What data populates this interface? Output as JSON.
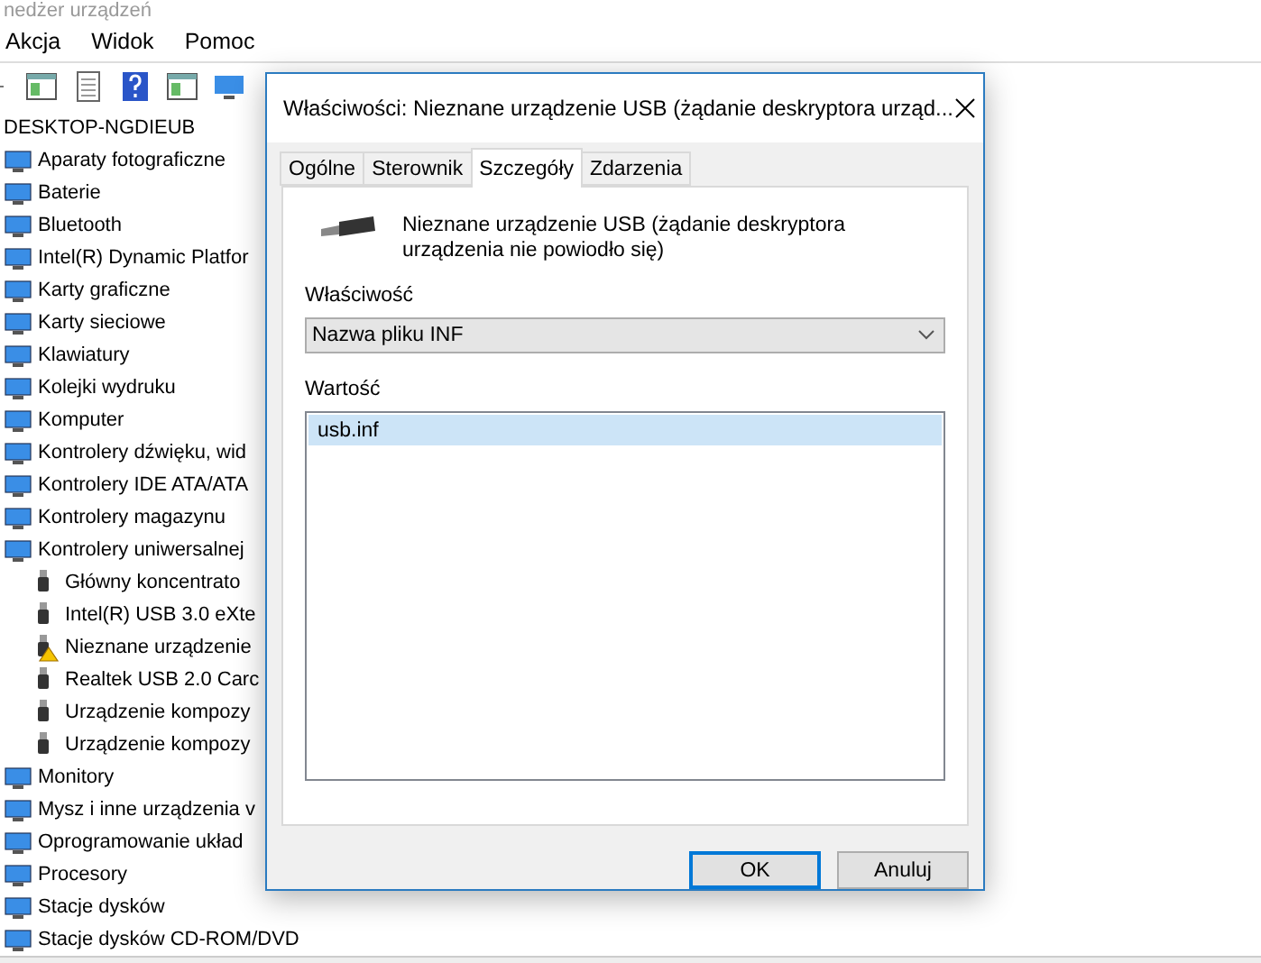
{
  "window": {
    "title": "nedżer urządzeń"
  },
  "menu": [
    "Akcja",
    "Widok",
    "Pomoc"
  ],
  "tree": {
    "label": "DESKTOP-NGDIEUB",
    "children": [
      {
        "label": "Aparaty fotograficzne"
      },
      {
        "label": "Baterie"
      },
      {
        "label": "Bluetooth"
      },
      {
        "label": "Intel(R) Dynamic Platfor"
      },
      {
        "label": "Karty graficzne"
      },
      {
        "label": "Karty sieciowe"
      },
      {
        "label": "Klawiatury"
      },
      {
        "label": "Kolejki wydruku"
      },
      {
        "label": "Komputer"
      },
      {
        "label": "Kontrolery dźwięku, wid"
      },
      {
        "label": "Kontrolery IDE ATA/ATA"
      },
      {
        "label": "Kontrolery magazynu"
      },
      {
        "label": "Kontrolery uniwersalnej",
        "children": [
          {
            "label": "Główny koncentrato",
            "warning": false
          },
          {
            "label": "Intel(R) USB 3.0 eXte",
            "warning": false
          },
          {
            "label": "Nieznane urządzenie",
            "warning": true
          },
          {
            "label": "Realtek USB 2.0 Carc",
            "warning": false
          },
          {
            "label": "Urządzenie kompozy",
            "warning": false
          },
          {
            "label": "Urządzenie kompozy",
            "warning": false
          }
        ]
      },
      {
        "label": "Monitory"
      },
      {
        "label": "Mysz i inne urządzenia v"
      },
      {
        "label": "Oprogramowanie układ"
      },
      {
        "label": "Procesory"
      },
      {
        "label": "Stacje dysków"
      },
      {
        "label": "Stacje dysków CD-ROM/DVD"
      }
    ]
  },
  "dialog": {
    "title": "Właściwości: Nieznane urządzenie USB (żądanie deskryptora urząd...",
    "tabs": [
      {
        "label": "Ogólne",
        "selected": false
      },
      {
        "label": "Sterownik",
        "selected": false
      },
      {
        "label": "Szczegóły",
        "selected": true
      },
      {
        "label": "Zdarzenia",
        "selected": false
      }
    ],
    "device_name": "Nieznane urządzenie USB (żądanie deskryptora urządzenia nie powiodło się)",
    "property_label": "Właściwość",
    "property_value": "Nazwa pliku INF",
    "value_label": "Wartość",
    "values": [
      {
        "text": "usb.inf",
        "selected": true
      }
    ],
    "buttons": [
      {
        "label": "OK",
        "default": true
      },
      {
        "label": "Anuluj",
        "default": false
      }
    ]
  }
}
